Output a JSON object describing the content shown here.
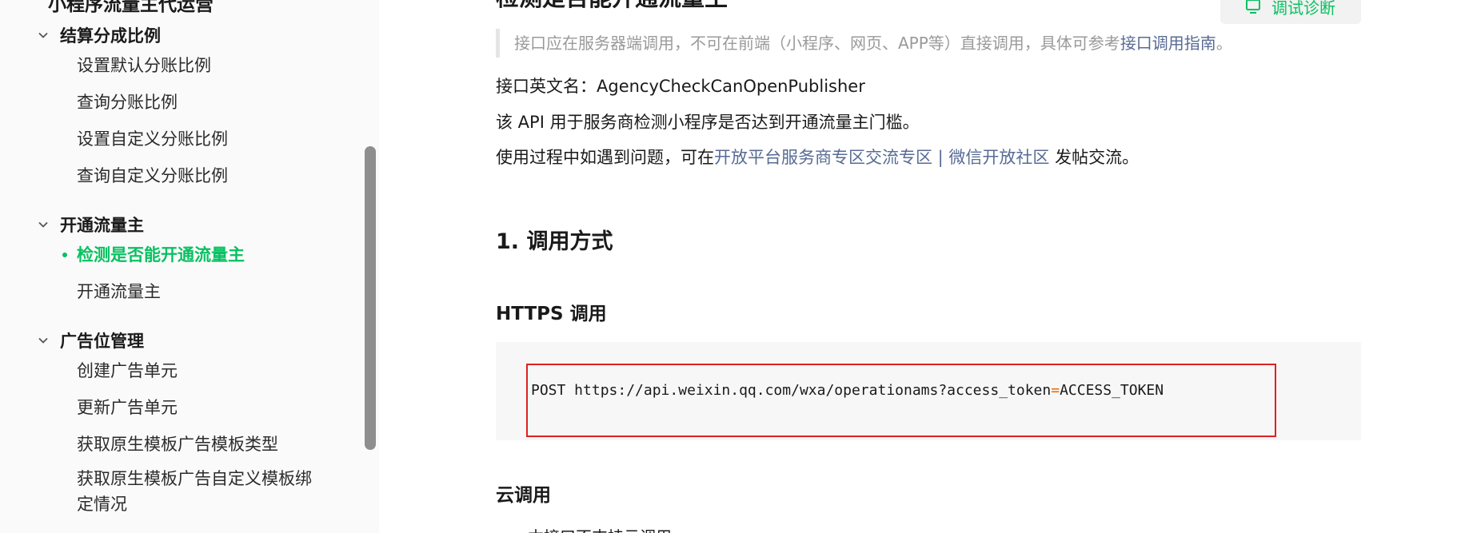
{
  "sidebar": {
    "clipped_title": "小程序流量主代运营",
    "sections": [
      {
        "title": "结算分成比例",
        "items": [
          "设置默认分账比例",
          "查询分账比例",
          "设置自定义分账比例",
          "查询自定义分账比例"
        ]
      },
      {
        "title": "开通流量主",
        "items": [
          "检测是否能开通流量主",
          "开通流量主"
        ],
        "active_item": "检测是否能开通流量主"
      },
      {
        "title": "广告位管理",
        "items": [
          "创建广告单元",
          "更新广告单元",
          "获取原生模板广告模板类型",
          "获取原生模板广告自定义模板绑定情况"
        ]
      }
    ]
  },
  "main": {
    "clipped_heading": "检测是否能开通流量主",
    "debug_button_label": "调试诊断",
    "notice": {
      "text": "接口应在服务器端调用，不可在前端（小程序、网页、APP等）直接调用，具体可参考",
      "link": "接口调用指南",
      "suffix": "。"
    },
    "api_name": "接口英文名：AgencyCheckCanOpenPublisher",
    "description": "该 API 用于服务商检测小程序是否达到开通流量主门槛。",
    "help": {
      "prefix": "使用过程中如遇到问题，可在",
      "link": "开放平台服务商专区交流专区 | 微信开放社区",
      "suffix": " 发帖交流。"
    },
    "section_heading": "1. 调用方式",
    "https_heading": "HTTPS 调用",
    "code": {
      "before": "POST https://api.weixin.qq.com/wxa/operationams?access_token",
      "operator": "=",
      "after": "ACCESS_TOKEN"
    },
    "cloud_heading": "云调用",
    "cloud_note_clipped": "本接口不支持云调用"
  },
  "colors": {
    "accent": "#07c160",
    "link": "#576b95",
    "highlight_border": "#e02020",
    "code_operator": "#e96900"
  }
}
